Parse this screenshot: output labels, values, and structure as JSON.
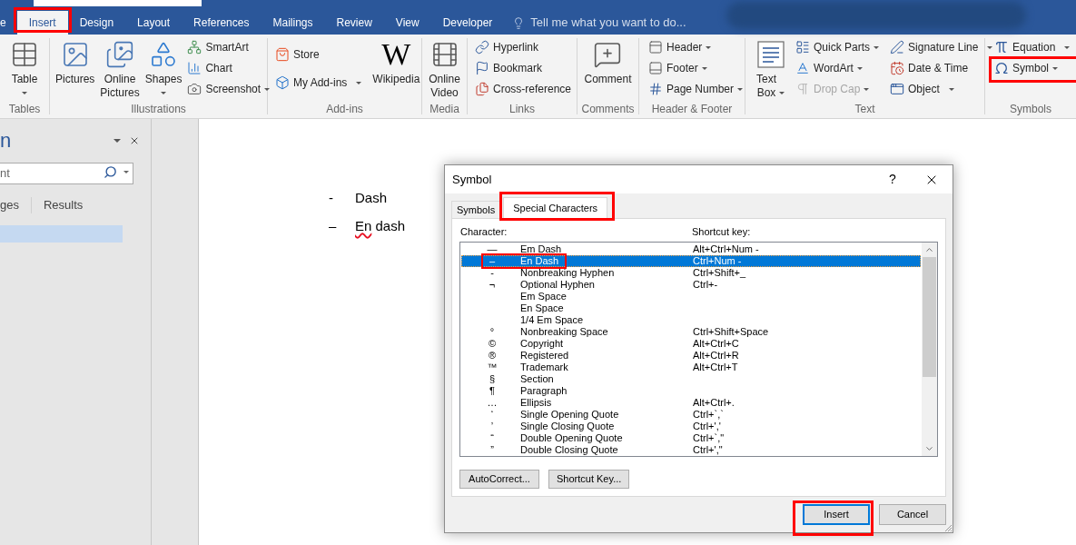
{
  "ribbon_tabs": [
    {
      "label": "e",
      "selected": false,
      "highlighted": false
    },
    {
      "label": "Insert",
      "selected": true,
      "highlighted": true
    },
    {
      "label": "Design",
      "selected": false,
      "highlighted": false
    },
    {
      "label": "Layout",
      "selected": false,
      "highlighted": false
    },
    {
      "label": "References",
      "selected": false,
      "highlighted": false
    },
    {
      "label": "Mailings",
      "selected": false,
      "highlighted": false
    },
    {
      "label": "Review",
      "selected": false,
      "highlighted": false
    },
    {
      "label": "View",
      "selected": false,
      "highlighted": false
    },
    {
      "label": "Developer",
      "selected": false,
      "highlighted": false
    }
  ],
  "tell_me": {
    "placeholder": "Tell me what you want to do..."
  },
  "ribbon_groups": [
    {
      "label": "Tables",
      "items": [
        {
          "kind": "large",
          "label": "Table",
          "dropdown": true
        }
      ]
    },
    {
      "label": "Illustrations",
      "items": [
        {
          "kind": "large",
          "label": "Pictures",
          "dropdown": false
        },
        {
          "kind": "large",
          "label": "Online Pictures",
          "dropdown": false
        },
        {
          "kind": "large",
          "label": "Shapes",
          "dropdown": true
        },
        {
          "kind": "stack",
          "buttons": [
            {
              "label": "SmartArt",
              "dropdown": false,
              "disabled": false,
              "highlighted": false
            },
            {
              "label": "Chart",
              "dropdown": false,
              "disabled": false,
              "highlighted": false
            },
            {
              "label": "Screenshot",
              "dropdown": true,
              "disabled": false,
              "highlighted": false
            }
          ]
        }
      ]
    },
    {
      "label": "Add-ins",
      "items": [
        {
          "kind": "stack",
          "buttons": [
            {
              "label": "Store",
              "dropdown": false,
              "disabled": false,
              "highlighted": false
            },
            {
              "label": "My Add-ins",
              "dropdown": true,
              "disabled": false,
              "highlighted": false
            }
          ]
        },
        {
          "kind": "large",
          "label": "Wikipedia",
          "logo": "W",
          "dropdown": false
        }
      ]
    },
    {
      "label": "Media",
      "items": [
        {
          "kind": "large",
          "label": "Online Video",
          "dropdown": false
        }
      ]
    },
    {
      "label": "Links",
      "items": [
        {
          "kind": "stack",
          "buttons": [
            {
              "label": "Hyperlink",
              "dropdown": false,
              "disabled": false,
              "highlighted": false
            },
            {
              "label": "Bookmark",
              "dropdown": false,
              "disabled": false,
              "highlighted": false
            },
            {
              "label": "Cross-reference",
              "dropdown": false,
              "disabled": false,
              "highlighted": false
            }
          ]
        }
      ]
    },
    {
      "label": "Comments",
      "items": [
        {
          "kind": "large",
          "label": "Comment",
          "dropdown": false
        }
      ]
    },
    {
      "label": "Header & Footer",
      "items": [
        {
          "kind": "stack",
          "buttons": [
            {
              "label": "Header",
              "dropdown": true,
              "disabled": false,
              "highlighted": false
            },
            {
              "label": "Footer",
              "dropdown": true,
              "disabled": false,
              "highlighted": false
            },
            {
              "label": "Page Number",
              "dropdown": true,
              "disabled": false,
              "highlighted": false
            }
          ]
        }
      ]
    },
    {
      "label": "Text",
      "items": [
        {
          "kind": "large",
          "label": "Text Box",
          "dropdown": true
        },
        {
          "kind": "stack",
          "buttons": [
            {
              "label": "Quick Parts",
              "dropdown": true,
              "disabled": false,
              "highlighted": false
            },
            {
              "label": "WordArt",
              "dropdown": true,
              "disabled": false,
              "highlighted": false
            },
            {
              "label": "Drop Cap",
              "dropdown": true,
              "disabled": true,
              "highlighted": false
            }
          ]
        },
        {
          "kind": "stack",
          "buttons": [
            {
              "label": "Signature Line",
              "dropdown": true,
              "disabled": false,
              "highlighted": false
            },
            {
              "label": "Date & Time",
              "dropdown": false,
              "disabled": false,
              "highlighted": false
            },
            {
              "label": "Object",
              "dropdown": true,
              "disabled": false,
              "highlighted": false
            }
          ]
        }
      ]
    },
    {
      "label": "Symbols",
      "items": [
        {
          "kind": "stack",
          "buttons": [
            {
              "label": "Equation",
              "dropdown": true,
              "disabled": false,
              "highlighted": false
            },
            {
              "label": "Symbol",
              "dropdown": true,
              "disabled": false,
              "highlighted": true
            }
          ]
        }
      ]
    }
  ],
  "navigation_pane": {
    "title": "n",
    "search": {
      "placeholder": "nt"
    },
    "tabs": [
      {
        "label": "ges",
        "selected": false
      },
      {
        "label": "Results",
        "selected": false
      }
    ],
    "headings": [
      {
        "selected": true
      }
    ]
  },
  "document": {
    "paragraphs": [
      {
        "marker": "-",
        "segments": [
          {
            "text": "Dash",
            "misspelled": false
          }
        ]
      },
      {
        "marker": "–",
        "segments": [
          {
            "text": "En",
            "misspelled": true
          },
          {
            "text": " dash",
            "misspelled": false
          }
        ]
      }
    ]
  },
  "dialog": {
    "title": "Symbol",
    "help_label": "?",
    "tabs": [
      {
        "label": "Symbols",
        "selected": false,
        "highlighted": false
      },
      {
        "label": "Special Characters",
        "selected": true,
        "highlighted": true
      }
    ],
    "columns": [
      "Character:",
      "Shortcut key:"
    ],
    "rows": [
      {
        "character": "—",
        "name": "Em Dash",
        "shortcut": "Alt+Ctrl+Num -",
        "selected": false,
        "highlighted": false
      },
      {
        "character": "–",
        "name": "En Dash",
        "shortcut": "Ctrl+Num -",
        "selected": true,
        "highlighted": true
      },
      {
        "character": "-",
        "name": "Nonbreaking Hyphen",
        "shortcut": "Ctrl+Shift+_",
        "selected": false,
        "highlighted": false
      },
      {
        "character": "¬",
        "name": "Optional Hyphen",
        "shortcut": "Ctrl+-",
        "selected": false,
        "highlighted": false
      },
      {
        "name": "Em Space",
        "selected": false,
        "highlighted": false
      },
      {
        "name": "En Space",
        "selected": false,
        "highlighted": false
      },
      {
        "name": "1/4 Em Space",
        "selected": false,
        "highlighted": false
      },
      {
        "character": "°",
        "name": "Nonbreaking Space",
        "shortcut": "Ctrl+Shift+Space",
        "selected": false,
        "highlighted": false
      },
      {
        "character": "©",
        "name": "Copyright",
        "shortcut": "Alt+Ctrl+C",
        "selected": false,
        "highlighted": false
      },
      {
        "character": "®",
        "name": "Registered",
        "shortcut": "Alt+Ctrl+R",
        "selected": false,
        "highlighted": false
      },
      {
        "character": "™",
        "name": "Trademark",
        "shortcut": "Alt+Ctrl+T",
        "selected": false,
        "highlighted": false
      },
      {
        "character": "§",
        "name": "Section",
        "selected": false,
        "highlighted": false
      },
      {
        "character": "¶",
        "name": "Paragraph",
        "selected": false,
        "highlighted": false
      },
      {
        "character": "…",
        "name": "Ellipsis",
        "shortcut": "Alt+Ctrl+.",
        "selected": false,
        "highlighted": false
      },
      {
        "character": "‘",
        "name": "Single Opening Quote",
        "shortcut": "Ctrl+`,`",
        "selected": false,
        "highlighted": false
      },
      {
        "character": "’",
        "name": "Single Closing Quote",
        "shortcut": "Ctrl+','",
        "selected": false,
        "highlighted": false
      },
      {
        "character": "“",
        "name": "Double Opening Quote",
        "shortcut": "Ctrl+`,\"",
        "selected": false,
        "highlighted": false
      },
      {
        "character": "”",
        "name": "Double Closing Quote",
        "shortcut": "Ctrl+',\"",
        "selected": false,
        "highlighted": false
      }
    ],
    "buttons": [
      {
        "label": "AutoCorrect..."
      },
      {
        "label": "Shortcut Key..."
      }
    ],
    "actions": [
      {
        "label": "Insert",
        "default": true,
        "highlighted": true
      },
      {
        "label": "Cancel",
        "default": false,
        "highlighted": false
      }
    ]
  }
}
